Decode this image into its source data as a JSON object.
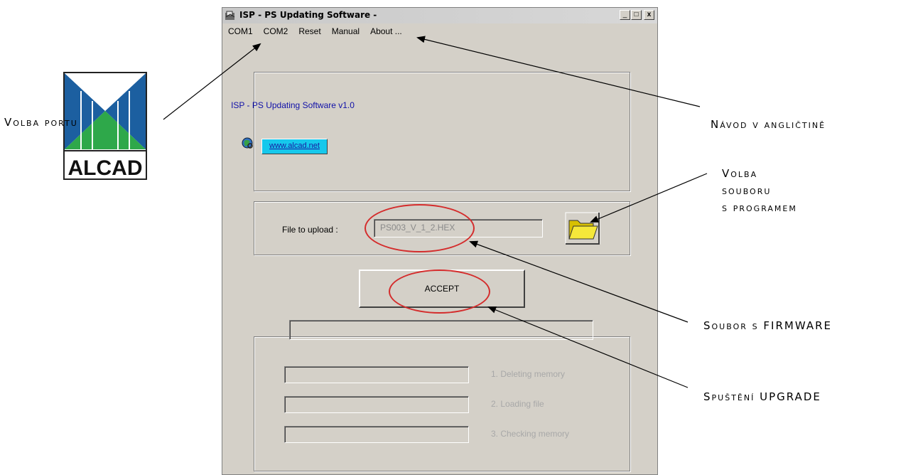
{
  "window": {
    "title": "ISP - PS Updating Software -",
    "caption_buttons": [
      "_",
      "□",
      "x"
    ],
    "icon": "app-icon"
  },
  "menu": {
    "items": [
      {
        "label": "COM1"
      },
      {
        "label": "COM2"
      },
      {
        "label": "Reset"
      },
      {
        "label": "Manual"
      },
      {
        "label": "About ..."
      }
    ]
  },
  "header": {
    "logo_text": "ALCAD",
    "app_version": "ISP - PS Updating Software v1.0",
    "url_button": "www.alcad.net",
    "globe_icon": "globe-icon"
  },
  "file_section": {
    "label": "File to upload :",
    "value": "PS003_V_1_2.HEX",
    "browse_icon": "folder-icon"
  },
  "accept_button": "ACCEPT",
  "progress": {
    "value": 0
  },
  "steps": [
    {
      "label": "1.  Deleting memory"
    },
    {
      "label": "2.  Loading file"
    },
    {
      "label": "3.  Checking memory"
    }
  ],
  "annotations": {
    "port": "Volba portu",
    "manual": "Návod v angličtině",
    "file_choice": [
      "Volba",
      "souboru",
      "s programem"
    ],
    "firmware": "Soubor s FIRMWARE",
    "upgrade": "Spuštění UPGRADE"
  },
  "colors": {
    "window_bg": "#d4d0c8",
    "annotation_highlight": "#d42c2c",
    "link_button_bg": "#16c8ec",
    "version_text": "#1010a8"
  }
}
